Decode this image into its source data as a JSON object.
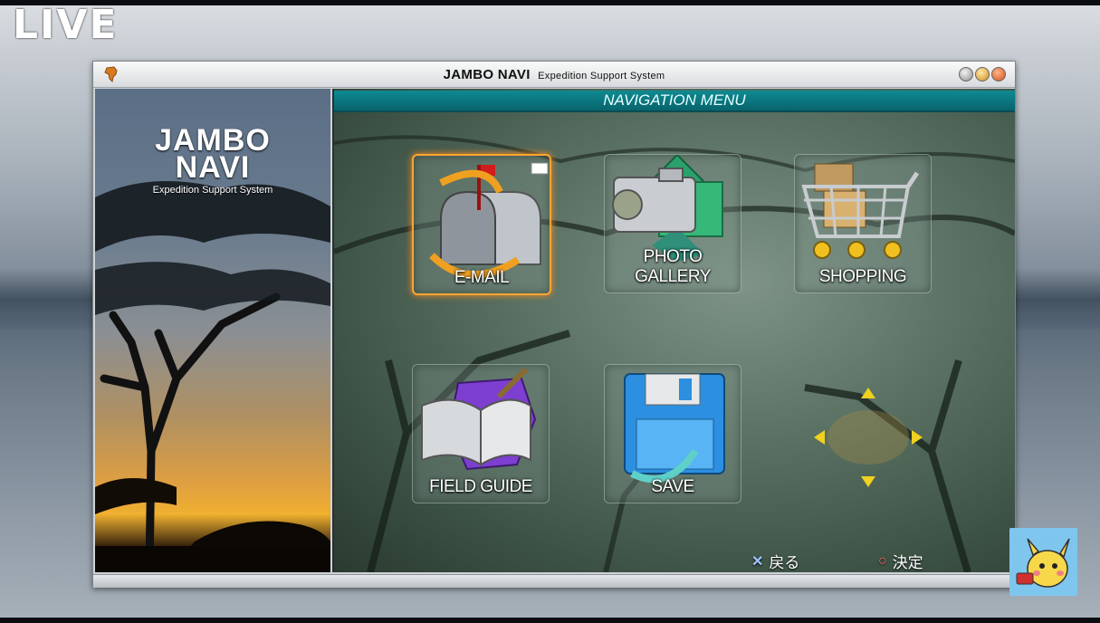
{
  "overlay": {
    "live_label": "LIVE"
  },
  "window": {
    "title": "JAMBO NAVI",
    "subtitle": "Expedition Support System"
  },
  "branding": {
    "line1": "JAMBO",
    "line2": "NAVI",
    "tagline": "Expedition Support System"
  },
  "menu": {
    "header": "NAVIGATION MENU",
    "items": [
      {
        "label": "E-MAIL",
        "icon": "mailbox-icon",
        "selected": true
      },
      {
        "label": "PHOTO GALLERY",
        "icon": "camera-icon",
        "selected": false
      },
      {
        "label": "SHOPPING",
        "icon": "shopping-cart-icon",
        "selected": false
      },
      {
        "label": "FIELD GUIDE",
        "icon": "book-icon",
        "selected": false
      },
      {
        "label": "SAVE",
        "icon": "floppy-disk-icon",
        "selected": false
      }
    ]
  },
  "controls": {
    "back_glyph": "✕",
    "back_label": "戻る",
    "confirm_glyph": "○",
    "confirm_label": "決定"
  },
  "colors": {
    "selection": "#ffa530",
    "header": "#0e8a92"
  }
}
